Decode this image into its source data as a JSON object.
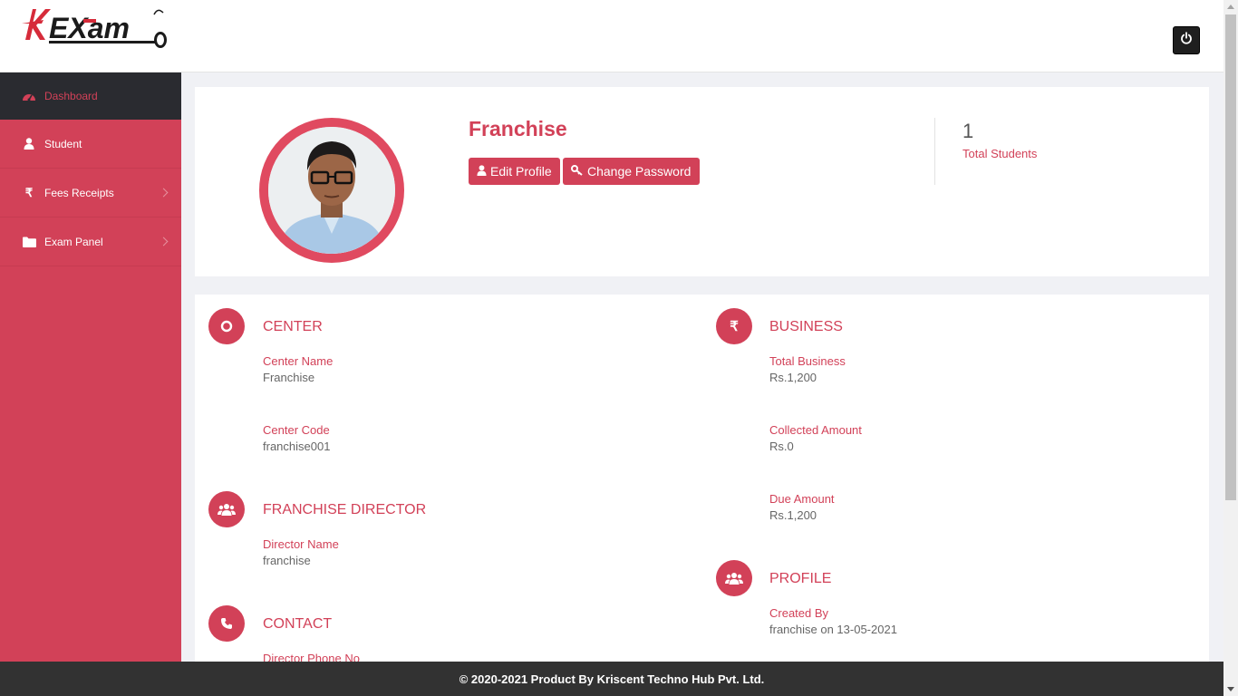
{
  "brand": {
    "logo_text": "EXAM",
    "accent": "#d24158",
    "dark": "#2a2b30"
  },
  "header": {
    "power_icon": "power-icon"
  },
  "sidebar": {
    "items": [
      {
        "label": "Dashboard",
        "icon": "dashboard-icon",
        "active": true
      },
      {
        "label": "Student",
        "icon": "user-icon"
      },
      {
        "label": "Fees Receipts",
        "icon": "rupee-icon",
        "has_submenu": true
      },
      {
        "label": "Exam Panel",
        "icon": "folder-icon",
        "has_submenu": true
      }
    ]
  },
  "profile": {
    "name": "Franchise",
    "edit_label": "Edit Profile",
    "password_label": "Change Password",
    "stat_value": "1",
    "stat_label": "Total Students"
  },
  "center": {
    "title": "CENTER",
    "name_label": "Center Name",
    "name_value": "Franchise",
    "code_label": "Center Code",
    "code_value": "franchise001"
  },
  "director": {
    "title": "FRANCHISE DIRECTOR",
    "name_label": "Director Name",
    "name_value": "franchise"
  },
  "contact": {
    "title": "CONTACT",
    "phone_label": "Director Phone No"
  },
  "business": {
    "title": "BUSINESS",
    "total_label": "Total Business",
    "total_value": "Rs.1,200",
    "collected_label": "Collected Amount",
    "collected_value": "Rs.0",
    "due_label": "Due Amount",
    "due_value": "Rs.1,200"
  },
  "profile_section": {
    "title": "PROFILE",
    "created_label": "Created By",
    "created_value": "franchise on 13-05-2021"
  },
  "footer": {
    "text": "© 2020-2021 Product By Kriscent Techno Hub Pvt. Ltd."
  }
}
